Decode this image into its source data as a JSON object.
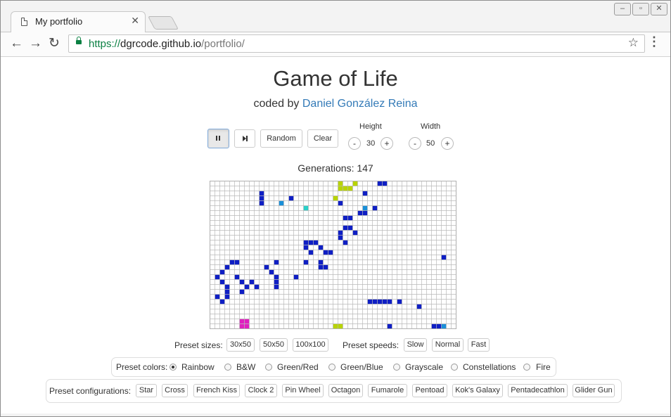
{
  "browser": {
    "tab_title": "My portfolio",
    "url_scheme": "https://",
    "url_host": "dgrcode.github.io",
    "url_path": "/portfolio/",
    "icons": [
      "page-icon",
      "close-icon",
      "back-icon",
      "forward-icon",
      "reload-icon",
      "lock-icon",
      "star-icon",
      "menu-icon"
    ]
  },
  "page": {
    "title": "Game of Life",
    "subtitle_prefix": "coded by",
    "author": "Daniel González Reina",
    "controls": {
      "pause_icon": "pause-icon",
      "step_icon": "step-forward-icon",
      "random_label": "Random",
      "clear_label": "Clear",
      "height_label": "Height",
      "height_value": "30",
      "width_label": "Width",
      "width_value": "50",
      "minus": "-",
      "plus": "+"
    },
    "generations_text": "Generations: 147",
    "preset_sizes_label": "Preset sizes:",
    "preset_sizes": [
      "30x50",
      "50x50",
      "100x100"
    ],
    "preset_speeds_label": "Preset speeds:",
    "preset_speeds": [
      "Slow",
      "Normal",
      "Fast"
    ],
    "preset_colors_label": "Preset colors:",
    "preset_colors": [
      "Rainbow",
      "B&W",
      "Green/Red",
      "Green/Blue",
      "Grayscale",
      "Constellations",
      "Fire"
    ],
    "selected_color": "Rainbow",
    "preset_configs_label": "Preset configurations:",
    "preset_configs": [
      "Star",
      "Cross",
      "French Kiss",
      "Clock 2",
      "Pin Wheel",
      "Octagon",
      "Fumarole",
      "Pentoad",
      "Kok's Galaxy",
      "Pentadecathlon",
      "Glider Gun"
    ]
  },
  "board": {
    "rows": 30,
    "cols": 50,
    "palette": {
      "b": "#0f1fc4",
      "l": "#1a8fd8",
      "c": "#2ad0c8",
      "y": "#b8d400",
      "m": "#e020c0"
    },
    "cells": [
      "..........................y..y....bb..............",
      "..........................yyy.....................",
      "..........b....................b..................",
      "..........b.....b........y.........................",
      "..........b...l...........b........................",
      "...................c...........l.b................",
      "..............................bb..................",
      "...........................bb......................",
      "..................................................",
      "...........................bb......................",
      "..........................b..b.....................",
      "..........................b........................",
      "...................bbb.....b.......................",
      "...................b..b...........................",
      "....................b..bb..........................",
      "...............................................b..",
      "....bb.......b.....b..b...........................",
      "...b.......b..........bb..........................",
      "..b.........b.....................................",
      ".b...b.......b...b................................",
      "..b...b.b....b....................................",
      "...b...b.b...b....................................",
      "...b..b...........................................",
      ".b.b..............................................",
      "..b.............................bbbbb.b..........",
      "..........................................b.......",
      "..................................................",
      "..................................................",
      "......mm..........................................",
      "......mm.................yy.........b........bbl."
    ]
  }
}
